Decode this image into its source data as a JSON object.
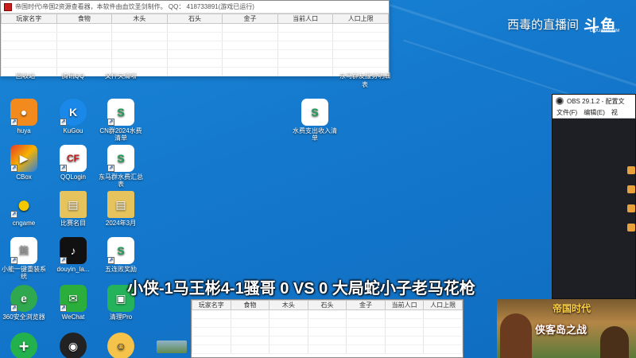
{
  "top_window": {
    "title": "帝国时代\\帝国2资源查看器，本软件由血饮圣剑制作。 QQ： 418733891(游戏已运行)",
    "columns": [
      "玩家名字",
      "食物",
      "木头",
      "石头",
      "金子",
      "当前人口",
      "人口上限"
    ]
  },
  "bottom_window": {
    "columns": [
      "玩家名字",
      "食物",
      "木头",
      "石头",
      "金子",
      "当前人口",
      "人口上限"
    ]
  },
  "watermark": {
    "text": "西毒的直播间",
    "logo": "斗鱼",
    "sub": "DOUYU.COM"
  },
  "obs": {
    "title": "OBS 29.1.2 - 配置文",
    "menu": [
      "文件(F)",
      "编辑(E)",
      "视"
    ]
  },
  "overlay_text": "小侠-1马王彬4-1骚哥 0 VS 0 大局蛇小子老马花枪",
  "ad": {
    "title": "帝国时代",
    "subtitle": "侠客岛之战"
  },
  "cut_labels": [
    "回收站",
    "腾讯QQ",
    "文件夹清晰",
    "东马群友服务明细表"
  ],
  "desktop_icons": [
    {
      "label": "huya",
      "color": "#f28a1d",
      "glyph": "●"
    },
    {
      "label": "KuGou",
      "color": "#1a88e8",
      "glyph": "K"
    },
    {
      "label": "CN群2024水费清单",
      "color": "#1f9d55",
      "glyph": "S"
    },
    {
      "label": "水费支出收入清单",
      "color": "#1f9d55",
      "glyph": "S"
    },
    {
      "label": "CBox",
      "color": "#e43b2a",
      "glyph": "▶"
    },
    {
      "label": "QQLogin",
      "color": "#c41d1d",
      "glyph": "CF"
    },
    {
      "label": "东马群水费汇总表",
      "color": "#1f9d55",
      "glyph": "S"
    },
    {
      "label": "cngame",
      "color": "#f5c800",
      "glyph": "●"
    },
    {
      "label": "比赛名目",
      "color": "#e6c35c",
      "glyph": "▤"
    },
    {
      "label": "2024年3月",
      "color": "#e6c35c",
      "glyph": "▤"
    },
    {
      "label": "小能一键重装系统",
      "color": "#ffffff",
      "glyph": "熊"
    },
    {
      "label": "douyin_la...",
      "color": "#111111",
      "glyph": "♪"
    },
    {
      "label": "五连败奖励",
      "color": "#1f9d55",
      "glyph": "S"
    },
    {
      "label": "360安全浏览器",
      "color": "#2fa84f",
      "glyph": "e"
    },
    {
      "label": "WeChat",
      "color": "#2bae3b",
      "glyph": "✉"
    },
    {
      "label": "清理Pro",
      "color": "#24b35a",
      "glyph": "▣"
    },
    {
      "label": "",
      "color": "#23b14d",
      "glyph": "+"
    },
    {
      "label": "",
      "color": "#222222",
      "glyph": "◉"
    },
    {
      "label": "",
      "color": "#f6c34a",
      "glyph": "☺"
    },
    {
      "label": "",
      "color": "#6b8f5a",
      "glyph": ""
    }
  ]
}
